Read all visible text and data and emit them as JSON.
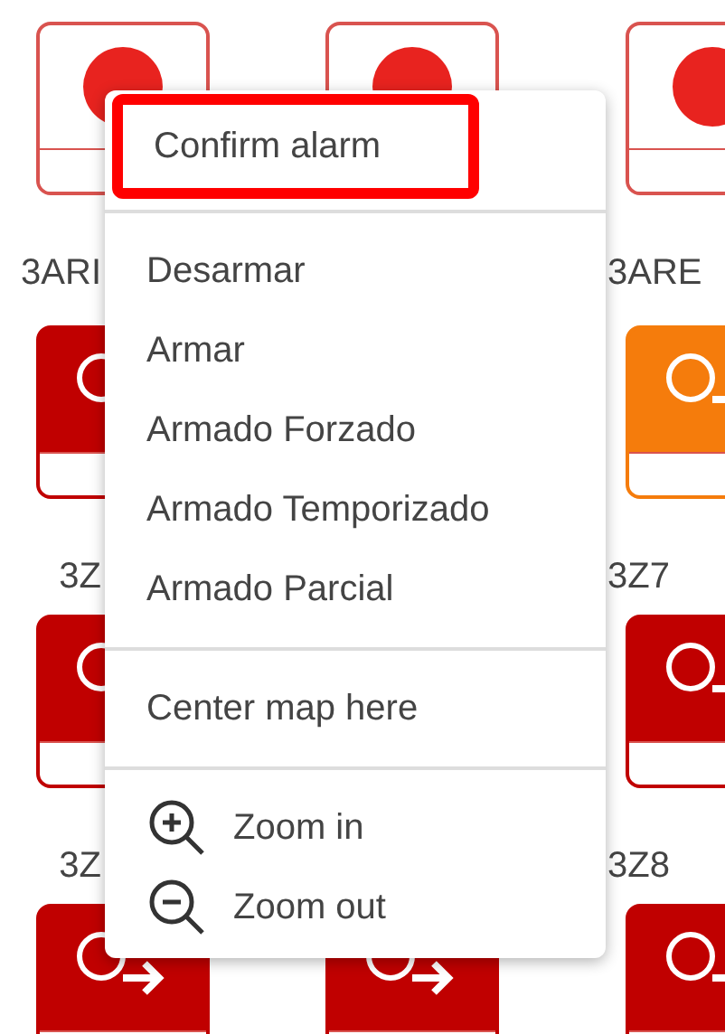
{
  "map": {
    "zone_rows": [
      [
        {
          "kind": "outline",
          "label": "3ARI"
        },
        {
          "kind": "outline"
        },
        {
          "kind": "outline",
          "label": "3ARE"
        }
      ],
      [
        {
          "kind": "solid",
          "label": "3Z"
        },
        null,
        {
          "kind": "orange",
          "label": "3Z7"
        }
      ],
      [
        {
          "kind": "solid",
          "label": "3Z"
        },
        null,
        {
          "kind": "solid",
          "label": "3Z8"
        }
      ],
      [
        {
          "kind": "solid"
        },
        {
          "kind": "solid"
        },
        {
          "kind": "solid"
        }
      ]
    ]
  },
  "context_menu": {
    "sections": [
      [
        {
          "label": "Confirm alarm",
          "highlighted": true
        }
      ],
      [
        {
          "label": "Desarmar",
          "highlighted": false
        },
        {
          "label": "Armar",
          "highlighted": false
        },
        {
          "label": "Armado Forzado",
          "highlighted": false
        },
        {
          "label": "Armado Temporizado",
          "highlighted": false
        },
        {
          "label": "Armado Parcial",
          "highlighted": false
        }
      ],
      [
        {
          "label": "Center map here",
          "highlighted": false
        }
      ],
      [
        {
          "label": "Zoom in",
          "highlighted": false,
          "kind": "zoomin"
        },
        {
          "label": "Zoom out",
          "highlighted": false,
          "kind": "zoomout"
        }
      ]
    ]
  }
}
